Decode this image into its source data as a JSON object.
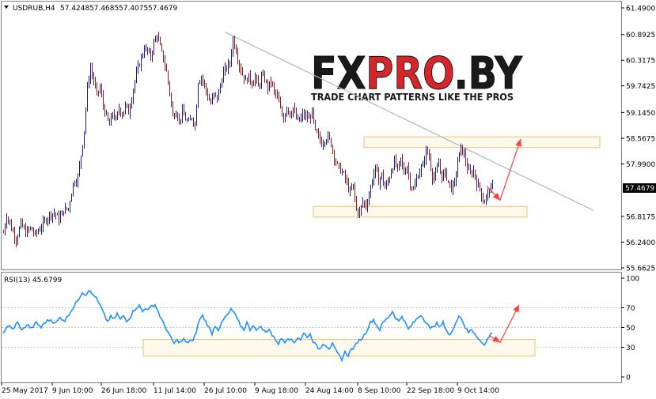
{
  "header": {
    "symbol_label": "USDRUB,H4",
    "ohlc": [
      "57.4248",
      "57.4685",
      "57.4075",
      "57.4679"
    ]
  },
  "rsi_label": "RSI(13) 45.6799",
  "watermark": {
    "brand_prefix": "FX",
    "brand_middle": "PRO",
    "brand_suffix": ".BY",
    "tagline": "TRADE CHART PATTERNS LIKE THE PROS"
  },
  "current_price_label": "57.4679",
  "colors": {
    "bull": "#1a1a8a",
    "bear": "#8b1a2a",
    "rsi": "#1e90ff",
    "trendline": "#aab8c8",
    "zone": "#f0c070",
    "arrow": "#ff3b3b",
    "brand_red": "#d7262a"
  },
  "chart_data": [
    {
      "type": "candlestick",
      "symbol": "USDRUB",
      "timeframe": "H4",
      "ylim": [
        55.6625,
        61.49
      ],
      "y_ticks": [
        "61.4900",
        "60.8925",
        "60.3175",
        "59.7425",
        "59.1450",
        "58.5675",
        "57.9900",
        "57.4679",
        "56.8175",
        "56.2400",
        "55.6625"
      ],
      "x_ticks": [
        "25 May 2017",
        "9 Jun 10:00",
        "26 Jun 18:00",
        "11 Jul 14:00",
        "26 Jul 10:00",
        "9 Aug 18:00",
        "24 Aug 14:00",
        "8 Sep 10:00",
        "22 Sep 18:00",
        "9 Oct 14:00"
      ],
      "close_path": [
        [
          0,
          56.45
        ],
        [
          4,
          56.85
        ],
        [
          10,
          56.55
        ],
        [
          16,
          56.3
        ],
        [
          22,
          56.65
        ],
        [
          28,
          56.45
        ],
        [
          34,
          56.55
        ],
        [
          40,
          56.4
        ],
        [
          46,
          56.55
        ],
        [
          52,
          56.7
        ],
        [
          58,
          56.85
        ],
        [
          64,
          56.9
        ],
        [
          70,
          56.75
        ],
        [
          76,
          56.95
        ],
        [
          82,
          57.0
        ],
        [
          88,
          57.55
        ],
        [
          94,
          57.7
        ],
        [
          98,
          58.2
        ],
        [
          102,
          58.75
        ],
        [
          106,
          59.7
        ],
        [
          110,
          60.15
        ],
        [
          114,
          59.85
        ],
        [
          118,
          59.55
        ],
        [
          122,
          59.7
        ],
        [
          126,
          59.3
        ],
        [
          130,
          59.05
        ],
        [
          134,
          58.85
        ],
        [
          138,
          59.15
        ],
        [
          142,
          58.95
        ],
        [
          146,
          59.25
        ],
        [
          150,
          59.1
        ],
        [
          154,
          59.3
        ],
        [
          158,
          59.15
        ],
        [
          162,
          59.5
        ],
        [
          166,
          59.85
        ],
        [
          170,
          60.15
        ],
        [
          174,
          60.35
        ],
        [
          178,
          60.6
        ],
        [
          182,
          60.5
        ],
        [
          186,
          60.4
        ],
        [
          190,
          60.7
        ],
        [
          194,
          60.9
        ],
        [
          198,
          60.6
        ],
        [
          202,
          60.35
        ],
        [
          206,
          60.05
        ],
        [
          210,
          59.6
        ],
        [
          214,
          59.05
        ],
        [
          218,
          59.2
        ],
        [
          222,
          58.95
        ],
        [
          226,
          59.15
        ],
        [
          230,
          59.0
        ],
        [
          234,
          58.9
        ],
        [
          238,
          59.05
        ],
        [
          242,
          58.85
        ],
        [
          246,
          59.85
        ],
        [
          250,
          59.95
        ],
        [
          254,
          59.75
        ],
        [
          258,
          59.5
        ],
        [
          262,
          59.35
        ],
        [
          266,
          59.55
        ],
        [
          270,
          59.45
        ],
        [
          274,
          59.75
        ],
        [
          278,
          60.05
        ],
        [
          282,
          60.15
        ],
        [
          286,
          60.25
        ],
        [
          290,
          60.8
        ],
        [
          294,
          60.55
        ],
        [
          298,
          60.2
        ],
        [
          302,
          60.0
        ],
        [
          306,
          59.85
        ],
        [
          310,
          59.95
        ],
        [
          314,
          59.8
        ],
        [
          318,
          59.95
        ],
        [
          322,
          59.7
        ],
        [
          326,
          59.95
        ],
        [
          330,
          59.9
        ],
        [
          334,
          59.7
        ],
        [
          338,
          59.85
        ],
        [
          342,
          59.6
        ],
        [
          346,
          59.5
        ],
        [
          350,
          59.2
        ],
        [
          354,
          59.0
        ],
        [
          358,
          59.3
        ],
        [
          362,
          59.1
        ],
        [
          366,
          59.25
        ],
        [
          370,
          59.0
        ],
        [
          374,
          58.95
        ],
        [
          378,
          59.1
        ],
        [
          382,
          59.05
        ],
        [
          386,
          59.0
        ],
        [
          390,
          59.15
        ],
        [
          394,
          58.7
        ],
        [
          398,
          58.6
        ],
        [
          402,
          58.45
        ],
        [
          406,
          58.55
        ],
        [
          410,
          58.6
        ],
        [
          414,
          58.45
        ],
        [
          418,
          58.15
        ],
        [
          422,
          57.95
        ],
        [
          426,
          57.85
        ],
        [
          430,
          57.75
        ],
        [
          434,
          57.55
        ],
        [
          438,
          57.35
        ],
        [
          442,
          57.5
        ],
        [
          446,
          56.95
        ],
        [
          450,
          56.9
        ],
        [
          454,
          57.15
        ],
        [
          458,
          57.05
        ],
        [
          462,
          57.3
        ],
        [
          466,
          57.65
        ],
        [
          470,
          57.9
        ],
        [
          474,
          57.6
        ],
        [
          478,
          57.75
        ],
        [
          482,
          57.45
        ],
        [
          486,
          57.6
        ],
        [
          490,
          57.85
        ],
        [
          494,
          58.05
        ],
        [
          498,
          57.85
        ],
        [
          502,
          58.1
        ],
        [
          506,
          57.8
        ],
        [
          510,
          57.95
        ],
        [
          514,
          57.55
        ],
        [
          518,
          57.4
        ],
        [
          522,
          57.65
        ],
        [
          526,
          57.85
        ],
        [
          530,
          57.95
        ],
        [
          534,
          58.3
        ],
        [
          538,
          58.15
        ],
        [
          542,
          57.7
        ],
        [
          546,
          57.75
        ],
        [
          550,
          58.0
        ],
        [
          554,
          57.7
        ],
        [
          558,
          57.8
        ],
        [
          562,
          57.6
        ],
        [
          566,
          57.45
        ],
        [
          570,
          57.55
        ],
        [
          574,
          58.05
        ],
        [
          578,
          58.35
        ],
        [
          582,
          58.2
        ],
        [
          586,
          57.9
        ],
        [
          590,
          57.75
        ],
        [
          594,
          57.85
        ],
        [
          598,
          57.55
        ],
        [
          602,
          57.45
        ],
        [
          606,
          57.15
        ],
        [
          610,
          57.25
        ],
        [
          614,
          57.4
        ],
        [
          618,
          57.47
        ]
      ],
      "trendline": [
        [
          284,
          60.95
        ],
        [
          750,
          56.95
        ]
      ],
      "resistance_zone": {
        "x": [
          460,
          758
        ],
        "y": [
          58.36,
          58.6
        ]
      },
      "support_zone": {
        "x": [
          396,
          666
        ],
        "y": [
          56.8,
          57.04
        ]
      },
      "projection_arrow": [
        [
          615,
          57.5
        ],
        [
          632,
          57.18
        ],
        [
          658,
          58.55
        ]
      ]
    },
    {
      "type": "line",
      "name": "RSI(13)",
      "ylim": [
        0,
        100
      ],
      "y_ticks": [
        "100",
        "70",
        "50",
        "30",
        "0"
      ],
      "levels": [
        30,
        70
      ],
      "current": 45.6799,
      "values": [
        [
          0,
          45
        ],
        [
          6,
          52
        ],
        [
          12,
          48
        ],
        [
          18,
          55
        ],
        [
          24,
          47
        ],
        [
          30,
          53
        ],
        [
          36,
          49
        ],
        [
          42,
          55
        ],
        [
          48,
          50
        ],
        [
          54,
          56
        ],
        [
          60,
          58
        ],
        [
          66,
          54
        ],
        [
          72,
          60
        ],
        [
          78,
          57
        ],
        [
          84,
          65
        ],
        [
          90,
          72
        ],
        [
          96,
          80
        ],
        [
          100,
          86
        ],
        [
          104,
          83
        ],
        [
          108,
          88
        ],
        [
          112,
          84
        ],
        [
          116,
          82
        ],
        [
          120,
          76
        ],
        [
          124,
          70
        ],
        [
          128,
          62
        ],
        [
          132,
          56
        ],
        [
          136,
          61
        ],
        [
          140,
          58
        ],
        [
          144,
          64
        ],
        [
          148,
          58
        ],
        [
          152,
          62
        ],
        [
          156,
          57
        ],
        [
          160,
          60
        ],
        [
          164,
          66
        ],
        [
          168,
          70
        ],
        [
          172,
          72
        ],
        [
          176,
          66
        ],
        [
          180,
          70
        ],
        [
          184,
          68
        ],
        [
          188,
          72
        ],
        [
          192,
          73
        ],
        [
          196,
          66
        ],
        [
          200,
          58
        ],
        [
          204,
          52
        ],
        [
          208,
          46
        ],
        [
          212,
          39
        ],
        [
          216,
          34
        ],
        [
          220,
          37
        ],
        [
          224,
          35
        ],
        [
          228,
          38
        ],
        [
          232,
          34
        ],
        [
          236,
          37
        ],
        [
          240,
          36
        ],
        [
          244,
          46
        ],
        [
          248,
          58
        ],
        [
          252,
          62
        ],
        [
          256,
          56
        ],
        [
          260,
          50
        ],
        [
          264,
          44
        ],
        [
          268,
          52
        ],
        [
          272,
          48
        ],
        [
          276,
          54
        ],
        [
          280,
          60
        ],
        [
          284,
          63
        ],
        [
          288,
          68
        ],
        [
          292,
          65
        ],
        [
          296,
          58
        ],
        [
          300,
          52
        ],
        [
          304,
          48
        ],
        [
          308,
          55
        ],
        [
          312,
          48
        ],
        [
          316,
          53
        ],
        [
          320,
          46
        ],
        [
          324,
          52
        ],
        [
          328,
          48
        ],
        [
          332,
          45
        ],
        [
          336,
          49
        ],
        [
          340,
          42
        ],
        [
          344,
          38
        ],
        [
          348,
          34
        ],
        [
          352,
          39
        ],
        [
          356,
          36
        ],
        [
          360,
          40
        ],
        [
          364,
          37
        ],
        [
          368,
          35
        ],
        [
          372,
          40
        ],
        [
          376,
          38
        ],
        [
          380,
          44
        ],
        [
          384,
          41
        ],
        [
          388,
          43
        ],
        [
          392,
          36
        ],
        [
          396,
          31
        ],
        [
          400,
          28
        ],
        [
          404,
          34
        ],
        [
          408,
          32
        ],
        [
          412,
          29
        ],
        [
          416,
          33
        ],
        [
          420,
          27
        ],
        [
          424,
          22
        ],
        [
          428,
          18
        ],
        [
          432,
          25
        ],
        [
          436,
          22
        ],
        [
          440,
          28
        ],
        [
          444,
          30
        ],
        [
          448,
          36
        ],
        [
          452,
          38
        ],
        [
          456,
          42
        ],
        [
          460,
          48
        ],
        [
          464,
          55
        ],
        [
          468,
          58
        ],
        [
          472,
          52
        ],
        [
          476,
          48
        ],
        [
          480,
          55
        ],
        [
          484,
          58
        ],
        [
          488,
          62
        ],
        [
          492,
          66
        ],
        [
          496,
          60
        ],
        [
          500,
          56
        ],
        [
          504,
          62
        ],
        [
          508,
          55
        ],
        [
          512,
          48
        ],
        [
          516,
          52
        ],
        [
          520,
          56
        ],
        [
          524,
          60
        ],
        [
          528,
          63
        ],
        [
          532,
          58
        ],
        [
          536,
          54
        ],
        [
          540,
          48
        ],
        [
          544,
          52
        ],
        [
          548,
          54
        ],
        [
          552,
          50
        ],
        [
          556,
          55
        ],
        [
          560,
          48
        ],
        [
          564,
          42
        ],
        [
          568,
          46
        ],
        [
          572,
          56
        ],
        [
          576,
          62
        ],
        [
          580,
          58
        ],
        [
          584,
          50
        ],
        [
          588,
          45
        ],
        [
          592,
          48
        ],
        [
          596,
          44
        ],
        [
          600,
          40
        ],
        [
          604,
          35
        ],
        [
          608,
          32
        ],
        [
          612,
          38
        ],
        [
          616,
          44
        ],
        [
          620,
          46
        ]
      ],
      "zone": {
        "x": [
          181,
          676
        ],
        "y": [
          21,
          38
        ]
      },
      "projection_arrow": [
        [
          618,
          42
        ],
        [
          632,
          35
        ],
        [
          656,
          73
        ]
      ]
    }
  ]
}
